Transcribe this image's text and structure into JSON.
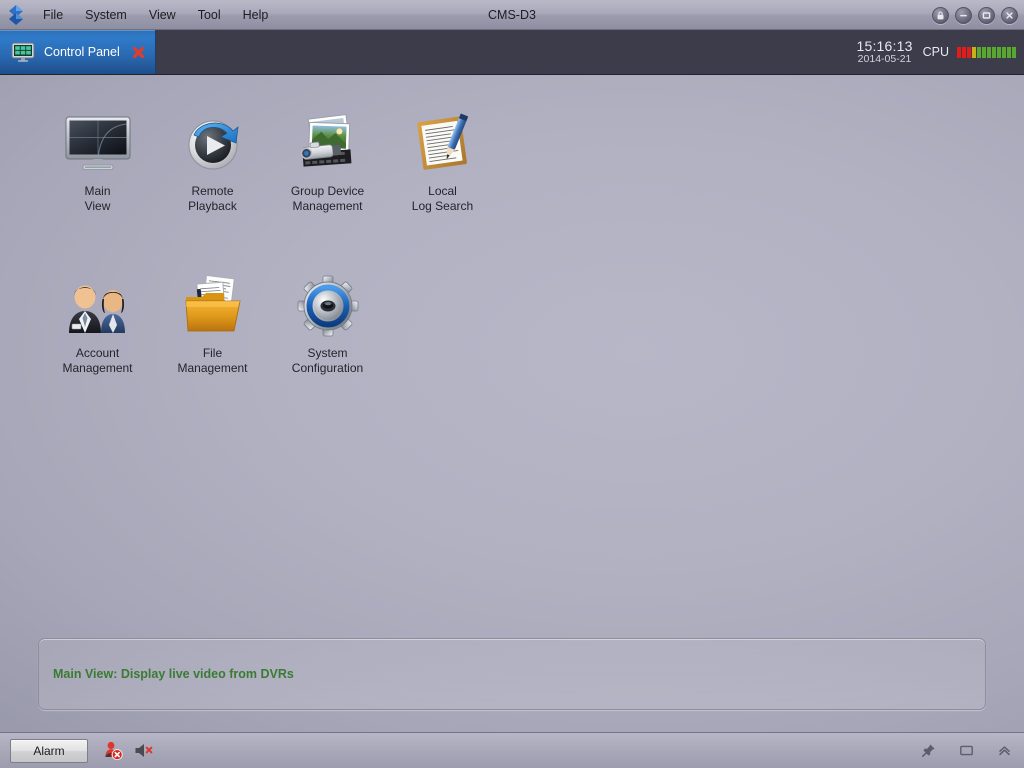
{
  "window": {
    "title": "CMS-D3",
    "logo_icon": "diamond-logo-icon",
    "menu": [
      {
        "label": "File",
        "name": "menu-file"
      },
      {
        "label": "System",
        "name": "menu-system"
      },
      {
        "label": "View",
        "name": "menu-view"
      },
      {
        "label": "Tool",
        "name": "menu-tool"
      },
      {
        "label": "Help",
        "name": "menu-help"
      }
    ],
    "controls": [
      {
        "name": "lock-button",
        "icon": "lock-icon"
      },
      {
        "name": "minimize-button",
        "icon": "minimize-icon"
      },
      {
        "name": "maximize-button",
        "icon": "maximize-icon"
      },
      {
        "name": "close-button",
        "icon": "close-icon"
      }
    ]
  },
  "tabbar": {
    "tab": {
      "label": "Control Panel",
      "icon": "control-panel-monitor-icon",
      "close_icon": "close-x-icon"
    },
    "status": {
      "time": "15:16:13",
      "date": "2014-05-21",
      "cpu_label": "CPU",
      "cpu_segments": [
        "#e21b1b",
        "#e21b1b",
        "#e21b1b",
        "#c9b019",
        "#58a830",
        "#58a830",
        "#58a830",
        "#58a830",
        "#58a830",
        "#58a830",
        "#58a830",
        "#58a830"
      ],
      "cpu_used_segments": 4,
      "cpu_total_segments": 12
    }
  },
  "desktop": {
    "icons": [
      {
        "name": "main-view",
        "label": "Main\nView",
        "icon": "monitor-icon"
      },
      {
        "name": "remote-playback",
        "label": "Remote\nPlayback",
        "icon": "playback-circle-icon"
      },
      {
        "name": "group-device-management",
        "label": "Group Device\nManagement",
        "icon": "camera-photos-icon"
      },
      {
        "name": "local-log-search",
        "label": "Local\nLog Search",
        "icon": "notepad-pen-icon"
      },
      {
        "name": "account-management",
        "label": "Account\nManagement",
        "icon": "two-users-icon"
      },
      {
        "name": "file-management",
        "label": "File\nManagement",
        "icon": "folder-documents-icon"
      },
      {
        "name": "system-configuration",
        "label": "System\nConfiguration",
        "icon": "gear-icon"
      }
    ],
    "description": "Main View: Display live video from DVRs"
  },
  "taskbar": {
    "alarm_label": "Alarm",
    "tray_left": [
      {
        "name": "alarm-user-disabled-icon",
        "icon": "user-alert-disabled-icon"
      },
      {
        "name": "audio-muted-icon",
        "icon": "speaker-muted-icon"
      }
    ],
    "tray_right": [
      {
        "name": "pin-icon",
        "icon": "pin-icon"
      },
      {
        "name": "window-icon",
        "icon": "window-icon"
      },
      {
        "name": "collapse-up-icon",
        "icon": "chevron-up-icon"
      }
    ]
  },
  "colors": {
    "accent_blue": "#2f7bc9",
    "desktop_bg": "#b1b1c2",
    "tabbar_bg": "#3c3c4a",
    "description_green": "#3a7b33",
    "alarm_red": "#e21b1b"
  }
}
